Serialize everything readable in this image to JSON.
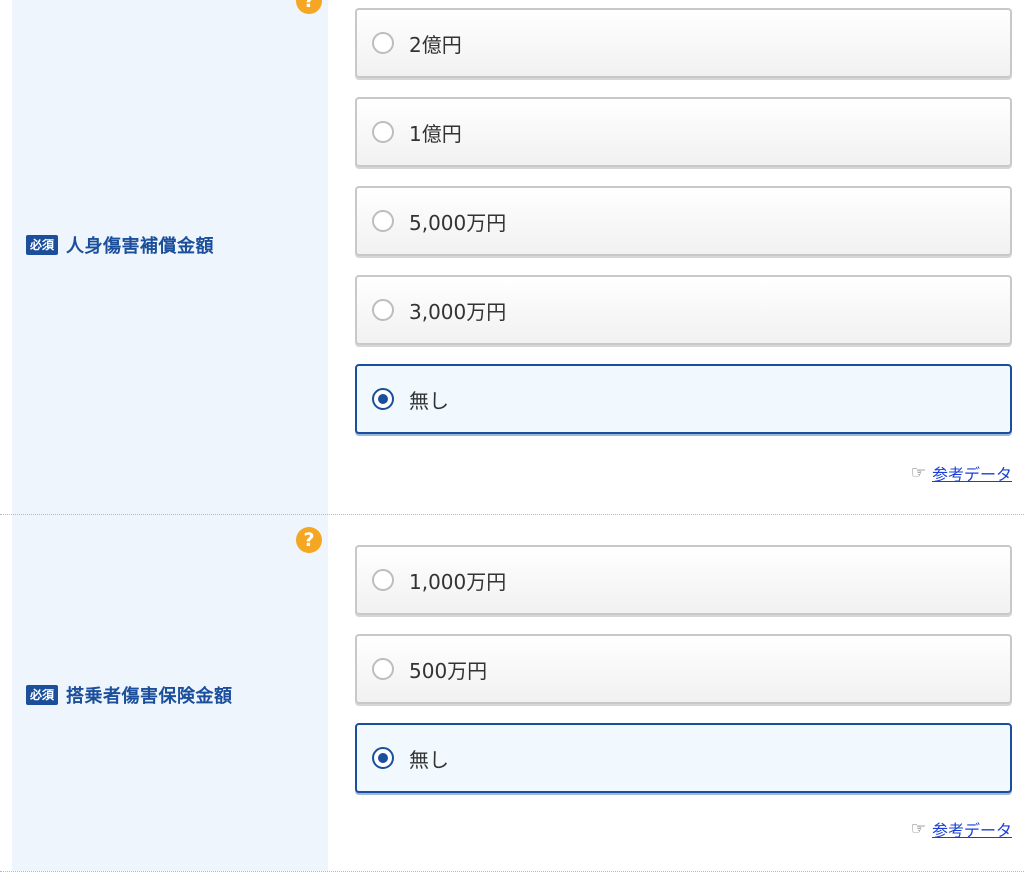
{
  "sections": [
    {
      "required_badge": "必須",
      "label": "人身傷害補償金額",
      "help_icon": "?",
      "options": [
        "2億円",
        "1億円",
        "5,000万円",
        "3,000万円",
        "無し"
      ],
      "selected": "無し",
      "ref_link": "参考データ"
    },
    {
      "required_badge": "必須",
      "label": "搭乗者傷害保険金額",
      "help_icon": "?",
      "options": [
        "1,000万円",
        "500万円",
        "無し"
      ],
      "selected": "無し",
      "ref_link": "参考データ"
    }
  ],
  "colors": {
    "label_bg": "#eef5fc",
    "accent": "#1b4f9c",
    "help": "#f5a623",
    "link": "#1a3fd6"
  },
  "icons": {
    "help": "question-circle-icon",
    "hand": "pointing-hand-icon"
  }
}
